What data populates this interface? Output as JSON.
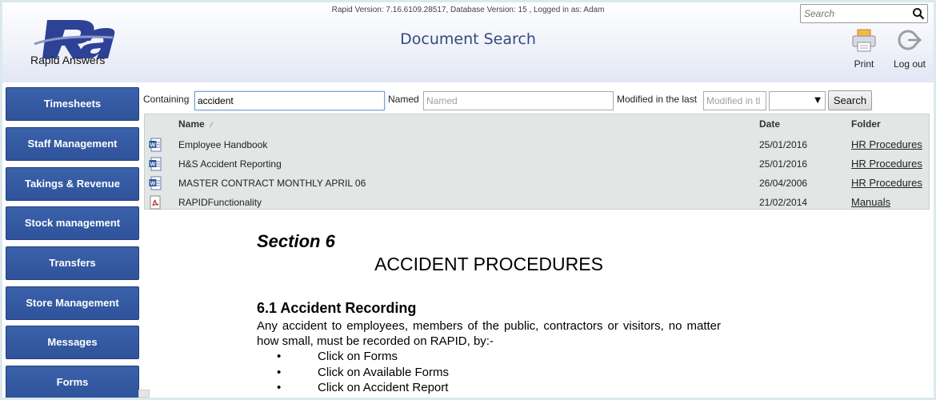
{
  "header": {
    "version_line": "Rapid Version: 7.16.6109.28517, Database Version: 15 , Logged in as: Adam",
    "title": "Document Search",
    "logo_text": "Rapid Answers",
    "search_placeholder": "Search",
    "print_label": "Print",
    "logout_label": "Log out"
  },
  "sidebar": {
    "items": [
      {
        "label": "Timesheets"
      },
      {
        "label": "Staff Management"
      },
      {
        "label": "Takings & Revenue"
      },
      {
        "label": "Stock management"
      },
      {
        "label": "Transfers"
      },
      {
        "label": "Store Management"
      },
      {
        "label": "Messages"
      },
      {
        "label": "Forms"
      }
    ]
  },
  "filters": {
    "containing_label": "Containing",
    "containing_value": "accident",
    "named_label": "Named",
    "named_placeholder": "Named",
    "modified_label": "Modified in the last",
    "modified_placeholder": "Modified in tl",
    "search_button": "Search"
  },
  "results": {
    "columns": {
      "name": "Name",
      "date": "Date",
      "folder": "Folder"
    },
    "rows": [
      {
        "icon": "word-doc-icon",
        "name": "Employee Handbook",
        "date": "25/01/2016",
        "folder": "HR Procedures"
      },
      {
        "icon": "word-doc-icon",
        "name": "H&S Accident Reporting",
        "date": "25/01/2016",
        "folder": "HR Procedures"
      },
      {
        "icon": "word-doc-icon",
        "name": "MASTER CONTRACT MONTHLY APRIL 06",
        "date": "26/04/2006",
        "folder": "HR Procedures"
      },
      {
        "icon": "pdf-doc-icon",
        "name": "RAPIDFunctionality",
        "date": "21/02/2014",
        "folder": "Manuals"
      }
    ]
  },
  "document": {
    "section": "Section 6",
    "heading": "ACCIDENT PROCEDURES",
    "subheading": "6.1 Accident Recording",
    "paragraph": "Any accident to employees, members of the public, contractors or visitors, no matter how small, must be recorded on RAPID, by:-",
    "bullets": [
      "Click on Forms",
      "Click on Available Forms",
      "Click on Accident Report"
    ]
  },
  "colors": {
    "nav_button": "#2f539b",
    "title": "#334a7a",
    "grid_bg": "#e2e7e5"
  }
}
